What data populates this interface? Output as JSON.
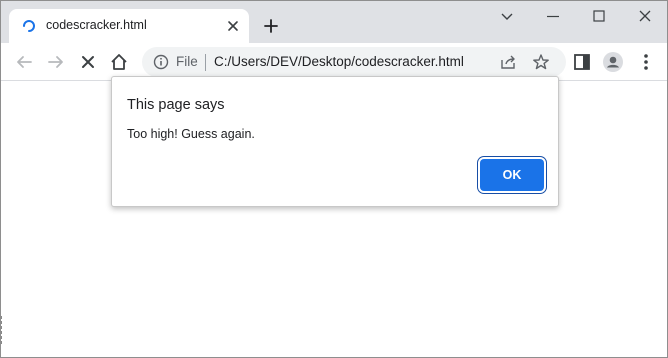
{
  "tab": {
    "title": "codescracker.html",
    "spinner_icon": "loading-spinner-icon",
    "close_icon": "close-icon"
  },
  "tabstrip": {
    "new_tab_icon": "plus-icon"
  },
  "window_controls": [
    "chevron-down-icon",
    "minimize-icon",
    "maximize-icon",
    "close-icon"
  ],
  "toolbar": {
    "back_icon": "arrow-left-icon",
    "forward_icon": "arrow-right-icon",
    "stop_icon": "close-icon",
    "home_icon": "home-icon",
    "side_panel_icon": "side-panel-icon",
    "profile_icon": "profile-icon",
    "menu_icon": "kebab-menu-icon"
  },
  "omnibox": {
    "scheme_label": "File",
    "url": "C:/Users/DEV/Desktop/codescracker.html",
    "info_icon": "info-icon",
    "share_icon": "share-icon",
    "bookmark_icon": "star-icon"
  },
  "dialog": {
    "title": "This page says",
    "message": "Too high! Guess again.",
    "ok_label": "OK"
  },
  "colors": {
    "accent": "#1a73e8",
    "tabstrip_bg": "#dfe1e5",
    "omnibox_bg": "#f1f3f4"
  }
}
